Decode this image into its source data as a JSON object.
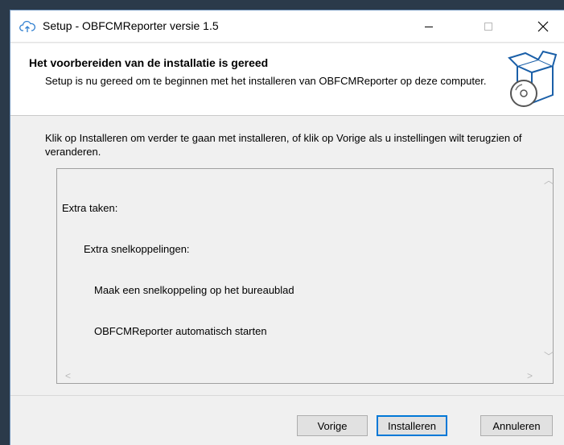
{
  "titlebar": {
    "title": "Setup - OBFCMReporter versie 1.5",
    "icon": "cloud-upload-icon",
    "minimize_glyph": "—",
    "maximize_glyph": "☐",
    "close_glyph": "✕"
  },
  "header": {
    "title": "Het voorbereiden van de installatie is gereed",
    "subtitle": "Setup is nu gereed om te beginnen met het installeren van OBFCMReporter op deze computer.",
    "graphic": "install-box-icon"
  },
  "main": {
    "instruction": "Klik op Installeren om verder te gaan met installeren, of klik op Vorige als u instellingen wilt terugzien of veranderen."
  },
  "memo": {
    "lines": [
      "Extra taken:",
      "Extra snelkoppelingen:",
      "Maak een snelkoppeling op het bureaublad",
      "OBFCMReporter automatisch starten"
    ]
  },
  "buttons": {
    "back": "Vorige",
    "install": "Installeren",
    "cancel": "Annuleren"
  },
  "colors": {
    "window_bg": "#f0f0f0",
    "header_bg": "#ffffff",
    "default_button_border": "#0078d7",
    "desktop_bg": "#2b3a4a"
  }
}
